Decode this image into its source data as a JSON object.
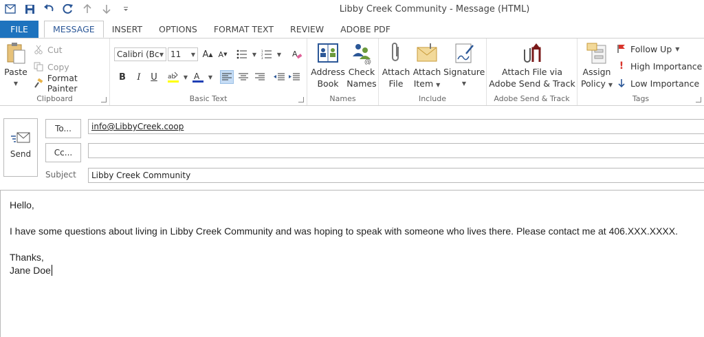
{
  "window": {
    "title": "Libby Creek Community - Message (HTML)"
  },
  "qat": [
    "save-icon",
    "undo-icon",
    "redo-icon",
    "up-arrow-icon",
    "down-arrow-icon",
    "customize-icon"
  ],
  "tabs": [
    {
      "label": "FILE"
    },
    {
      "label": "MESSAGE",
      "active": true
    },
    {
      "label": "INSERT"
    },
    {
      "label": "OPTIONS"
    },
    {
      "label": "FORMAT TEXT"
    },
    {
      "label": "REVIEW"
    },
    {
      "label": "ADOBE PDF"
    }
  ],
  "ribbon": {
    "clipboard": {
      "label": "Clipboard",
      "paste": "Paste",
      "cut": "Cut",
      "copy": "Copy",
      "format_painter": "Format Painter"
    },
    "basic_text": {
      "label": "Basic Text",
      "font": "Calibri (Bc",
      "size": "11"
    },
    "names": {
      "label": "Names",
      "address_book_1": "Address",
      "address_book_2": "Book",
      "check_names_1": "Check",
      "check_names_2": "Names"
    },
    "include": {
      "label": "Include",
      "attach_file_1": "Attach",
      "attach_file_2": "File",
      "attach_item_1": "Attach",
      "attach_item_2": "Item",
      "signature": "Signature"
    },
    "adobe": {
      "label": "Adobe Send & Track",
      "btn_1": "Attach File via",
      "btn_2": "Adobe Send & Track"
    },
    "tags": {
      "label": "Tags",
      "assign_1": "Assign",
      "assign_2": "Policy",
      "follow_up": "Follow Up",
      "high": "High Importance",
      "low": "Low Importance"
    }
  },
  "compose": {
    "send_label": "Send",
    "to_button": "To...",
    "cc_button": "Cc...",
    "to_value": "info@LibbyCreek.coop",
    "cc_value": "",
    "subject_label": "Subject",
    "subject_value": "Libby Creek Community"
  },
  "body": {
    "line1": "Hello,",
    "line2": "I have some questions about living in Libby Creek Community and was hoping to speak with someone who lives there. Please contact me at 406.XXX.XXXX.",
    "line3": "Thanks,",
    "line4": "Jane Doe"
  },
  "colors": {
    "accent": "#1e73be",
    "highlight": "#ffff00",
    "font_color": "#1f3fb4"
  }
}
